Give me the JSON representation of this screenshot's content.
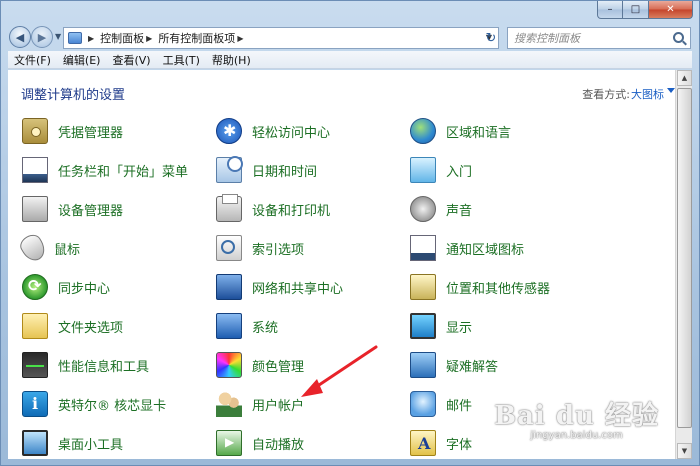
{
  "window": {
    "caption": {
      "minimize": "–",
      "maximize": "□",
      "close": "✕"
    }
  },
  "navigation": {
    "back_glyph": "◀",
    "forward_glyph": "▶",
    "breadcrumb": [
      "控制面板",
      "所有控制面板项"
    ],
    "search_placeholder": "搜索控制面板",
    "refresh_glyph": "↻"
  },
  "menubar": [
    "文件(F)",
    "编辑(E)",
    "查看(V)",
    "工具(T)",
    "帮助(H)"
  ],
  "content": {
    "title": "调整计算机的设置",
    "view_by_label": "查看方式:",
    "view_by_value": "大图标"
  },
  "items": [
    {
      "label": "凭据管理器",
      "icon": "credential-vault-icon"
    },
    {
      "label": "轻松访问中心",
      "icon": "ease-of-access-icon"
    },
    {
      "label": "区域和语言",
      "icon": "globe-icon"
    },
    {
      "label": "任务栏和「开始」菜单",
      "icon": "taskbar-icon"
    },
    {
      "label": "日期和时间",
      "icon": "clock-icon"
    },
    {
      "label": "入门",
      "icon": "getting-started-icon"
    },
    {
      "label": "设备管理器",
      "icon": "device-manager-icon"
    },
    {
      "label": "设备和打印机",
      "icon": "printer-icon"
    },
    {
      "label": "声音",
      "icon": "speaker-icon"
    },
    {
      "label": "鼠标",
      "icon": "mouse-icon"
    },
    {
      "label": "索引选项",
      "icon": "indexing-icon"
    },
    {
      "label": "通知区域图标",
      "icon": "notification-area-icon"
    },
    {
      "label": "同步中心",
      "icon": "sync-icon"
    },
    {
      "label": "网络和共享中心",
      "icon": "network-icon"
    },
    {
      "label": "位置和其他传感器",
      "icon": "sensor-icon"
    },
    {
      "label": "文件夹选项",
      "icon": "folder-icon"
    },
    {
      "label": "系统",
      "icon": "system-icon"
    },
    {
      "label": "显示",
      "icon": "display-icon"
    },
    {
      "label": "性能信息和工具",
      "icon": "performance-icon"
    },
    {
      "label": "颜色管理",
      "icon": "color-management-icon"
    },
    {
      "label": "疑难解答",
      "icon": "troubleshooting-icon"
    },
    {
      "label": "英特尔® 核芯显卡",
      "icon": "intel-graphics-icon"
    },
    {
      "label": "用户帐户",
      "icon": "user-accounts-icon"
    },
    {
      "label": "邮件",
      "icon": "mail-icon"
    },
    {
      "label": "桌面小工具",
      "icon": "gadgets-icon"
    },
    {
      "label": "自动播放",
      "icon": "autoplay-icon"
    },
    {
      "label": "字体",
      "icon": "fonts-icon"
    }
  ],
  "watermark": {
    "logo": "Bai du 经验",
    "url": "jingyan.baidu.com"
  },
  "colors": {
    "link_green": "#1c6f24",
    "title_blue": "#1e3a8a",
    "arrow_red": "#e8232a"
  }
}
